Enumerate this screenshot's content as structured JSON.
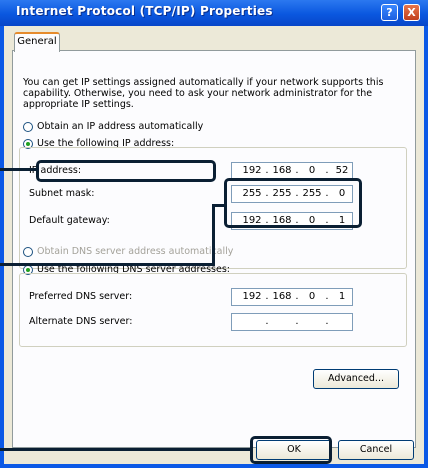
{
  "window": {
    "title": "Internet Protocol (TCP/IP) Properties",
    "help_symbol": "?",
    "close_symbol": "X"
  },
  "tabs": [
    {
      "label": "General"
    }
  ],
  "intro_text": "You can get IP settings assigned automatically if your network supports this capability. Otherwise, you need to ask your network administrator for the appropriate IP settings.",
  "ip_section": {
    "auto_label": "Obtain an IP address automatically",
    "manual_label": "Use the following IP address:",
    "selected": "manual",
    "fields": [
      {
        "label": "IP address:",
        "octets": [
          "192",
          "168",
          "0",
          "52"
        ]
      },
      {
        "label": "Subnet mask:",
        "octets": [
          "255",
          "255",
          "255",
          "0"
        ]
      },
      {
        "label": "Default gateway:",
        "octets": [
          "192",
          "168",
          "0",
          "1"
        ]
      }
    ]
  },
  "dns_section": {
    "auto_label": "Obtain DNS server address automatically",
    "manual_label": "Use the following DNS server addresses:",
    "selected": "manual",
    "fields": [
      {
        "label": "Preferred DNS server:",
        "octets": [
          "192",
          "168",
          "0",
          "1"
        ]
      },
      {
        "label": "Alternate DNS server:",
        "octets": [
          "",
          "",
          "",
          ""
        ]
      }
    ]
  },
  "buttons": {
    "advanced": "Advanced...",
    "ok": "OK",
    "cancel": "Cancel"
  },
  "colors": {
    "titlebar": "#0a57df",
    "dialog_bg": "#ece9d8",
    "callout": "#0a1f33"
  }
}
